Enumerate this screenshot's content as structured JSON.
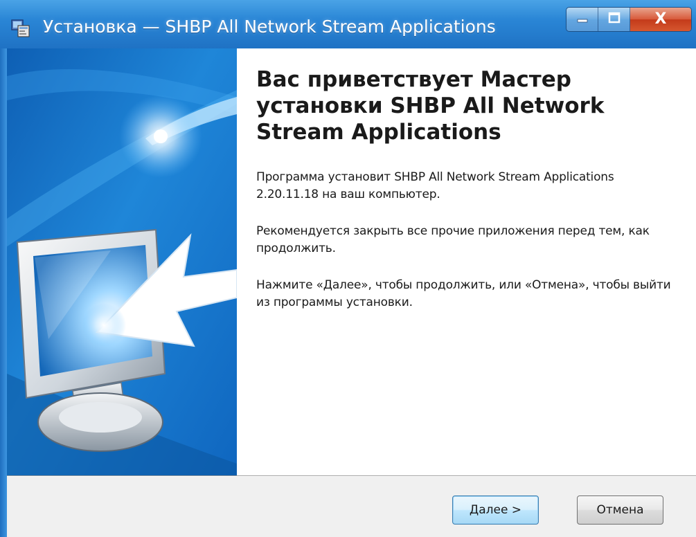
{
  "window": {
    "title": "Установка — SHBP All Network Stream Applications",
    "icon": "setup-icon",
    "controls": {
      "minimize_icon": "minimize-icon",
      "maximize_icon": "maximize-icon",
      "close_label": "X"
    }
  },
  "content": {
    "heading": "Вас приветствует Мастер установки SHBP All Network Stream Applications",
    "paragraphs": [
      "Программа установит SHBP All Network Stream Applications 2.20.11.18 на ваш компьютер.",
      "Рекомендуется закрыть все прочие приложения перед тем, как продолжить.",
      "Нажмите «Далее», чтобы продолжить, или «Отмена», чтобы выйти из программы установки."
    ]
  },
  "buttons": {
    "next_label": "Далее >",
    "cancel_label": "Отмена"
  },
  "colors": {
    "titlebar": "#2a86d6",
    "banner": "#1f7fd0",
    "footer": "#f0f0f0"
  }
}
